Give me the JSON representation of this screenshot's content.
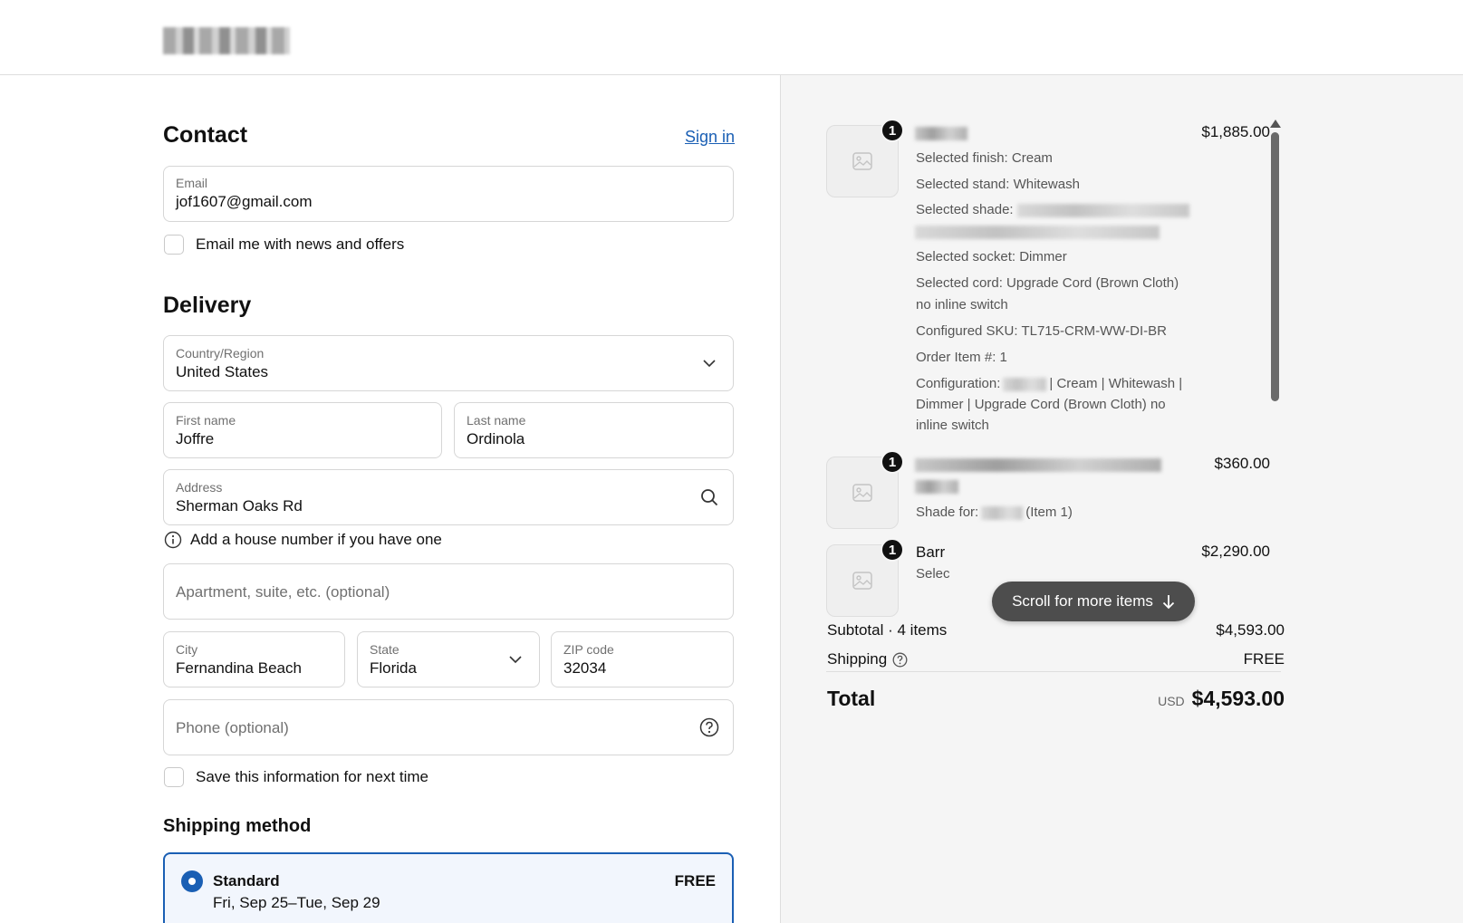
{
  "header": {
    "logo_alt": "store-logo"
  },
  "contact": {
    "title": "Contact",
    "sign_in": "Sign in",
    "email_label": "Email",
    "email_value": "jof1607@gmail.com",
    "news_checkbox_label": "Email me with news and offers"
  },
  "delivery": {
    "title": "Delivery",
    "country_label": "Country/Region",
    "country_value": "United States",
    "first_name_label": "First name",
    "first_name_value": "Joffre",
    "last_name_label": "Last name",
    "last_name_value": "Ordinola",
    "address_label": "Address",
    "address_value": "Sherman Oaks Rd",
    "address_hint": "Add a house number if you have one",
    "apartment_placeholder": "Apartment, suite, etc. (optional)",
    "city_label": "City",
    "city_value": "Fernandina Beach",
    "state_label": "State",
    "state_value": "Florida",
    "zip_label": "ZIP code",
    "zip_value": "32034",
    "phone_placeholder": "Phone (optional)",
    "save_info_label": "Save this information for next time"
  },
  "shipping_method": {
    "title": "Shipping method",
    "option_name": "Standard",
    "option_dates": "Fri, Sep 25–Tue, Sep 29",
    "option_price": "FREE"
  },
  "order": {
    "items": [
      {
        "qty": "1",
        "price": "$1,885.00",
        "lines": [
          "Selected finish: Cream",
          "Selected stand: Whitewash",
          "Selected shade:",
          "Selected socket: Dimmer",
          "Selected cord: Upgrade Cord (Brown Cloth)",
          "no inline switch",
          "Configured SKU: TL715-CRM-WW-DI-BR",
          "Order Item #: 1",
          "Configuration:",
          "| Cream | Whitewash |",
          "Dimmer | Upgrade Cord (Brown Cloth) no",
          "inline switch"
        ]
      },
      {
        "qty": "1",
        "price": "$360.00",
        "lines": [
          "Shade for:",
          "(Item 1)"
        ]
      },
      {
        "qty": "1",
        "price": "$2,290.00",
        "name": "Barr",
        "lines": [
          "Selec"
        ]
      }
    ],
    "scroll_pill": "Scroll for more items",
    "subtotal_label": "Subtotal · 4 items",
    "subtotal_value": "$4,593.00",
    "shipping_label": "Shipping",
    "shipping_value": "FREE",
    "total_label": "Total",
    "total_currency": "USD",
    "total_value": "$4,593.00"
  },
  "colors": {
    "accent": "#1a5fb4",
    "summary_bg": "#f5f5f5"
  }
}
